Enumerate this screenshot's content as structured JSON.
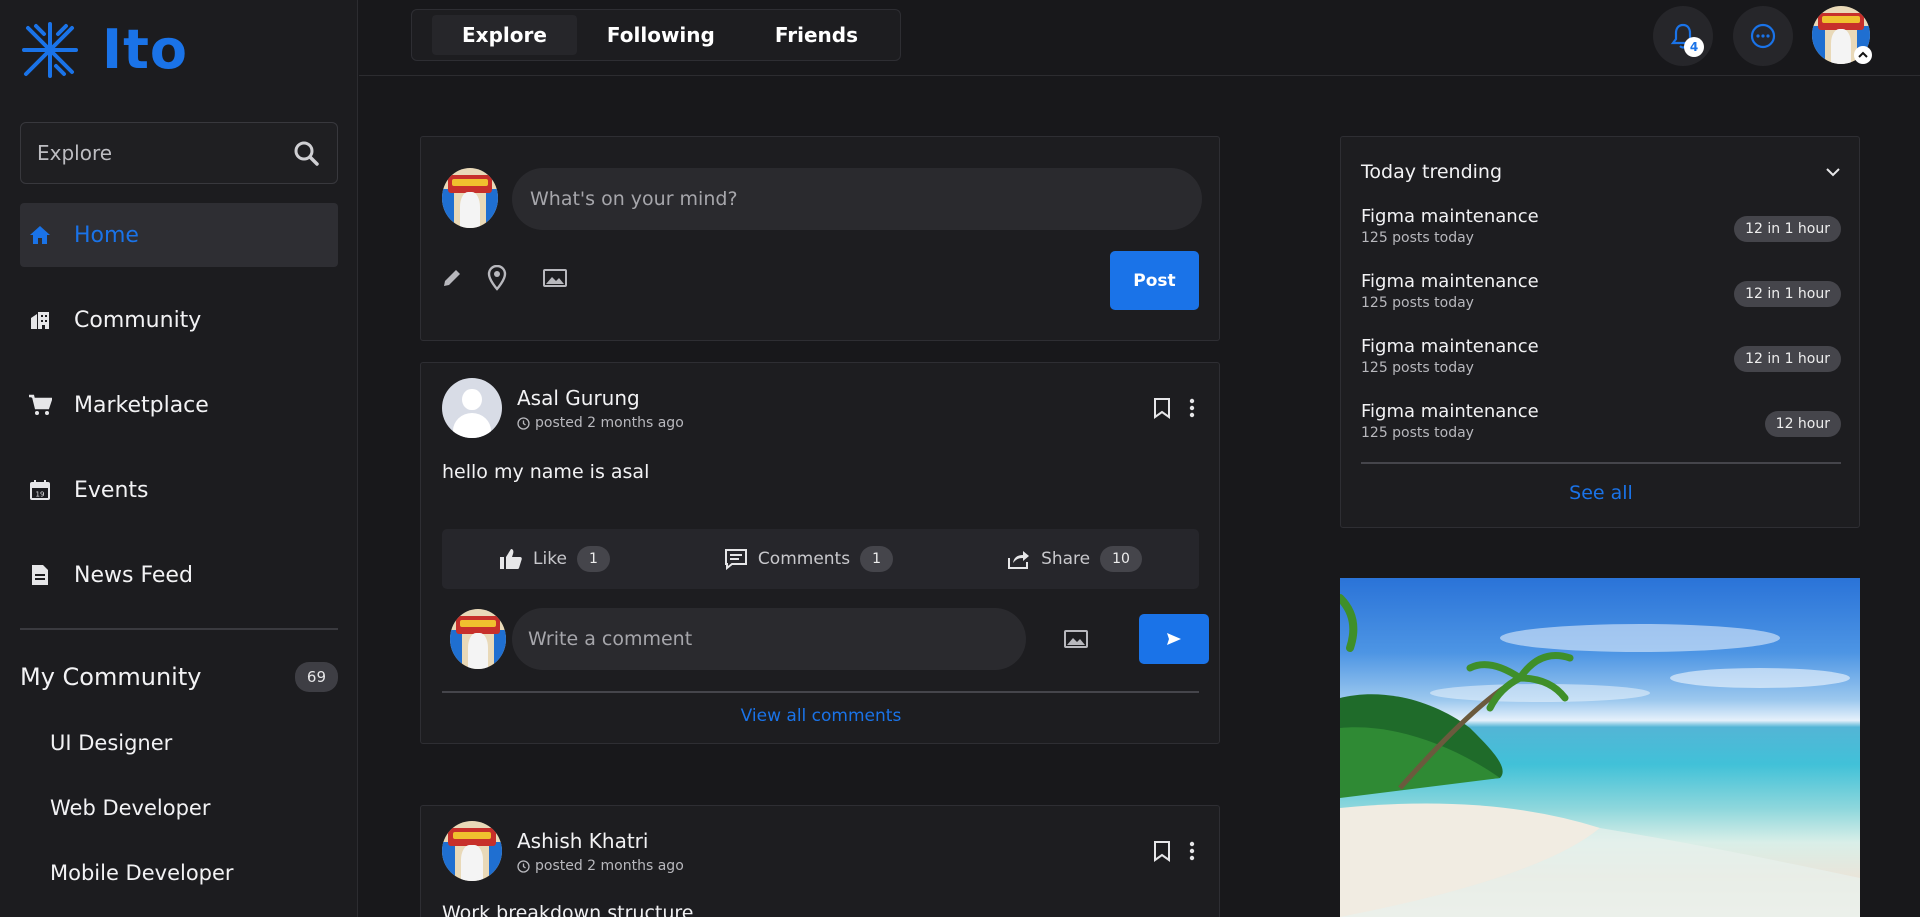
{
  "app": {
    "name": "Ito"
  },
  "colors": {
    "accent": "#1a73e8",
    "background": "#18181b",
    "card": "#1d1d20"
  },
  "search": {
    "placeholder": "Explore"
  },
  "sidebar": {
    "items": [
      {
        "label": "Home",
        "icon": "home-icon",
        "active": true
      },
      {
        "label": "Community",
        "icon": "community-icon"
      },
      {
        "label": "Marketplace",
        "icon": "cart-icon"
      },
      {
        "label": "Events",
        "icon": "calendar-icon"
      },
      {
        "label": "News Feed",
        "icon": "document-icon"
      }
    ],
    "my_community": {
      "title": "My Community",
      "count": "69"
    },
    "communities": [
      "UI Designer",
      "Web Developer",
      "Mobile Developer"
    ]
  },
  "header": {
    "tabs": [
      "Explore",
      "Following",
      "Friends"
    ],
    "notification_count": "4"
  },
  "composer": {
    "placeholder": "What's on your mind?",
    "post_label": "Post"
  },
  "posts": [
    {
      "author": "Asal Gurung",
      "time": "posted 2 months ago",
      "text": "hello my name is asal",
      "like_label": "Like",
      "like_count": "1",
      "comments_label": "Comments",
      "comments_count": "1",
      "share_label": "Share",
      "share_count": "10",
      "comment_placeholder": "Write a comment",
      "view_all": "View all comments"
    },
    {
      "author": "Ashish Khatri",
      "time": "posted 2 months ago",
      "text": "Work breakdown structure"
    }
  ],
  "trending": {
    "title": "Today trending",
    "items": [
      {
        "name": "Figma maintenance",
        "sub": "125 posts today",
        "badge": "12 in 1 hour"
      },
      {
        "name": "Figma maintenance",
        "sub": "125 posts today",
        "badge": "12 in 1 hour"
      },
      {
        "name": "Figma maintenance",
        "sub": "125 posts today",
        "badge": "12 in 1 hour"
      },
      {
        "name": "Figma maintenance",
        "sub": "125 posts today",
        "badge": "12 hour"
      }
    ],
    "see_all": "See all"
  }
}
